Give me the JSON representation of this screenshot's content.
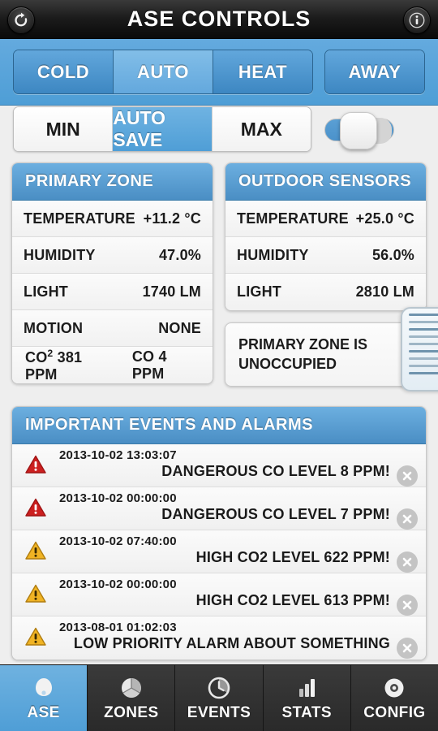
{
  "titlebar": {
    "title": "ASE CONTROLS",
    "refresh_icon": "refresh-icon",
    "info_icon": "info-icon"
  },
  "mode_control": {
    "buttons": [
      {
        "label": "COLD",
        "selected": false
      },
      {
        "label": "AUTO",
        "selected": true
      },
      {
        "label": "HEAT",
        "selected": false
      }
    ],
    "away": {
      "label": "AWAY",
      "selected": false
    }
  },
  "save_control": {
    "buttons": [
      {
        "label": "MIN",
        "selected": false
      },
      {
        "label": "AUTO SAVE",
        "selected": true
      },
      {
        "label": "MAX",
        "selected": false
      }
    ],
    "toggle": {
      "name": "power-toggle",
      "state": "on"
    }
  },
  "primary_zone": {
    "title": "PRIMARY ZONE",
    "rows": [
      {
        "label": "TEMPERATURE",
        "value": "+11.2 °C"
      },
      {
        "label": "HUMIDITY",
        "value": "47.0%"
      },
      {
        "label": "LIGHT",
        "value": "1740 LM"
      },
      {
        "label": "MOTION",
        "value": "NONE"
      }
    ],
    "gas_row": {
      "co2_label": "CO",
      "co2_sup": "2",
      "co2_value": "381 PPM",
      "co_value": "CO 4 PPM"
    }
  },
  "outdoor_sensors": {
    "title": "OUTDOOR SENSORS",
    "rows": [
      {
        "label": "TEMPERATURE",
        "value": "+25.0 °C"
      },
      {
        "label": "HUMIDITY",
        "value": "56.0%"
      },
      {
        "label": "LIGHT",
        "value": "2810 LM"
      }
    ]
  },
  "occupancy_note": {
    "text": "PRIMARY ZONE IS UNOCCUPIED"
  },
  "events": {
    "title": "IMPORTANT EVENTS AND ALARMS",
    "rows": [
      {
        "severity": "critical",
        "timestamp": "2013-10-02 13:03:07",
        "message": "DANGEROUS CO LEVEL 8 PPM!",
        "dismiss_icon": "close-circle-icon"
      },
      {
        "severity": "critical",
        "timestamp": "2013-10-02 00:00:00",
        "message": "DANGEROUS CO LEVEL 7 PPM!",
        "dismiss_icon": "close-circle-icon"
      },
      {
        "severity": "warning",
        "timestamp": "2013-10-02 07:40:00",
        "message": "HIGH CO2 LEVEL 622 PPM!",
        "dismiss_icon": "close-circle-icon"
      },
      {
        "severity": "warning",
        "timestamp": "2013-10-02 00:00:00",
        "message": "HIGH CO2 LEVEL 613 PPM!",
        "dismiss_icon": "close-circle-icon"
      },
      {
        "severity": "warning",
        "timestamp": "2013-08-01 01:02:03",
        "message": "LOW PRIORITY ALARM ABOUT SOMETHING",
        "dismiss_icon": "close-circle-icon"
      }
    ]
  },
  "tabbar": {
    "tabs": [
      {
        "label": "ASE",
        "icon": "dome-sensor-icon",
        "active": true
      },
      {
        "label": "ZONES",
        "icon": "cube-icon",
        "active": false
      },
      {
        "label": "EVENTS",
        "icon": "clock-icon",
        "active": false
      },
      {
        "label": "STATS",
        "icon": "bar-chart-icon",
        "active": false
      },
      {
        "label": "CONFIG",
        "icon": "gear-ring-icon",
        "active": false
      }
    ]
  },
  "colors": {
    "accent_blue": "#4f9ed6",
    "header_blue": "#5aa0d6",
    "critical_red": "#cc1f1f",
    "warning_amber": "#f0b323",
    "page_bg": "#eeeeee",
    "titlebar_black": "#1b1b1b"
  }
}
